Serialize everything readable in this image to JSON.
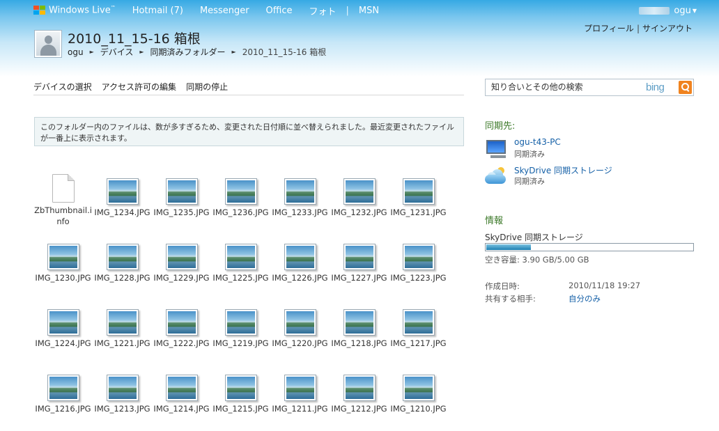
{
  "header": {
    "logo_text": "Windows Live",
    "logo_tm": "™",
    "nav": [
      {
        "label": "Hotmail (7)"
      },
      {
        "label": "Messenger"
      },
      {
        "label": "Office"
      },
      {
        "label": "フォト"
      },
      {
        "label": "MSN"
      }
    ],
    "separator": "|",
    "user_name": "ogu",
    "user_caret": "▼",
    "profile_link": "プロフィール",
    "signout_link": "サインアウト",
    "links_separator": "|"
  },
  "page": {
    "title": "2010_11_15-16 箱根",
    "breadcrumb": [
      {
        "label": "ogu"
      },
      {
        "label": "デバイス"
      },
      {
        "label": "同期済みフォルダー"
      },
      {
        "label": "2010_11_15-16 箱根"
      }
    ],
    "breadcrumb_arrow": "►"
  },
  "toolbar": {
    "items": [
      "デバイスの選択",
      "アクセス許可の編集",
      "同期の停止"
    ]
  },
  "notice": "このフォルダー内のファイルは、数が多すぎるため、変更された日付順に並べ替えられました。最近変更されたファイルが一番上に表示されます。",
  "files": [
    {
      "name": "ZbThumbnail.info",
      "type": "doc"
    },
    {
      "name": "IMG_1234.JPG",
      "type": "image"
    },
    {
      "name": "IMG_1235.JPG",
      "type": "image"
    },
    {
      "name": "IMG_1236.JPG",
      "type": "image"
    },
    {
      "name": "IMG_1233.JPG",
      "type": "image"
    },
    {
      "name": "IMG_1232.JPG",
      "type": "image"
    },
    {
      "name": "IMG_1231.JPG",
      "type": "image"
    },
    {
      "name": "IMG_1230.JPG",
      "type": "image"
    },
    {
      "name": "IMG_1228.JPG",
      "type": "image"
    },
    {
      "name": "IMG_1229.JPG",
      "type": "image"
    },
    {
      "name": "IMG_1225.JPG",
      "type": "image"
    },
    {
      "name": "IMG_1226.JPG",
      "type": "image"
    },
    {
      "name": "IMG_1227.JPG",
      "type": "image"
    },
    {
      "name": "IMG_1223.JPG",
      "type": "image"
    },
    {
      "name": "IMG_1224.JPG",
      "type": "image"
    },
    {
      "name": "IMG_1221.JPG",
      "type": "image"
    },
    {
      "name": "IMG_1222.JPG",
      "type": "image"
    },
    {
      "name": "IMG_1219.JPG",
      "type": "image"
    },
    {
      "name": "IMG_1220.JPG",
      "type": "image"
    },
    {
      "name": "IMG_1218.JPG",
      "type": "image"
    },
    {
      "name": "IMG_1217.JPG",
      "type": "image"
    },
    {
      "name": "IMG_1216.JPG",
      "type": "image"
    },
    {
      "name": "IMG_1213.JPG",
      "type": "image"
    },
    {
      "name": "IMG_1214.JPG",
      "type": "image"
    },
    {
      "name": "IMG_1215.JPG",
      "type": "image"
    },
    {
      "name": "IMG_1211.JPG",
      "type": "image"
    },
    {
      "name": "IMG_1212.JPG",
      "type": "image"
    },
    {
      "name": "IMG_1210.JPG",
      "type": "image"
    }
  ],
  "sidebar": {
    "search_placeholder": "知り合いとその他の検索",
    "search_brand": "bing",
    "sync_title": "同期先:",
    "sync_targets": [
      {
        "name": "ogu-t43-PC",
        "status": "同期済み",
        "icon": "computer-icon"
      },
      {
        "name": "SkyDrive 同期ストレージ",
        "status": "同期済み",
        "icon": "skydrive-cloud-icon"
      }
    ],
    "info_title": "情報",
    "storage_label": "SkyDrive 同期ストレージ",
    "storage_used_fraction": 0.22,
    "storage_free": "空き容量: 3.90 GB/5.00 GB",
    "created_label": "作成日時:",
    "created_value": "2010/11/18 19:27",
    "shared_label": "共有する相手:",
    "shared_value": "自分のみ"
  },
  "colors": {
    "header_gradient_top": "#36a9e4",
    "link": "#1560a7",
    "section_title": "#3d7a2a",
    "bing_button": "#f0831f"
  }
}
